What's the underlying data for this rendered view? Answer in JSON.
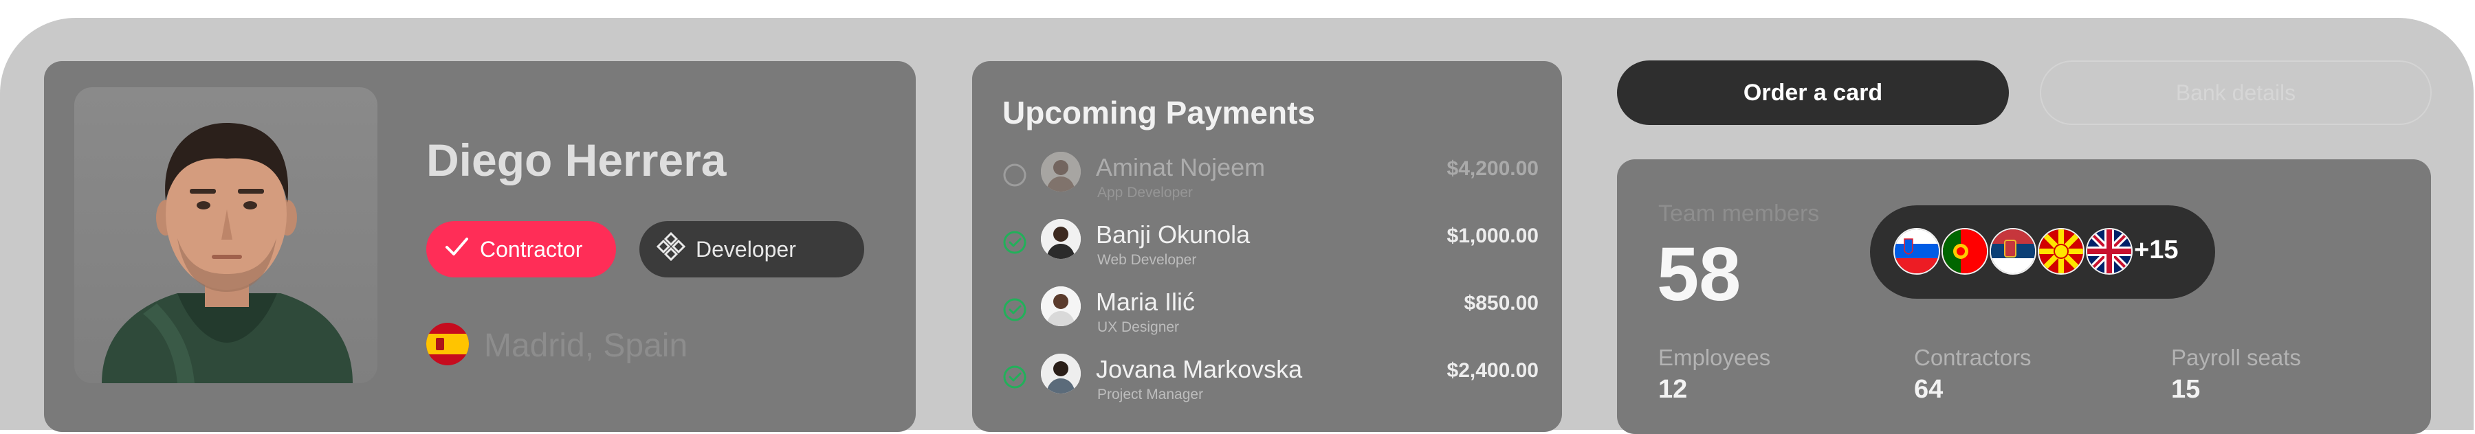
{
  "profile": {
    "name": "Diego Herrera",
    "tags": [
      "Contractor",
      "Developer"
    ],
    "location": "Madrid, Spain"
  },
  "payments": {
    "title": "Upcoming Payments",
    "items": [
      {
        "name": "Aminat Nojeem",
        "role": "App Developer",
        "amount": "$4,200.00",
        "status": "pending"
      },
      {
        "name": "Banji Okunola",
        "role": "Web Developer",
        "amount": "$1,000.00",
        "status": "done"
      },
      {
        "name": "Maria Ilić",
        "role": "UX Designer",
        "amount": "$850.00",
        "status": "done"
      },
      {
        "name": "Jovana Markovska",
        "role": "Project Manager",
        "amount": "$2,400.00",
        "status": "done"
      }
    ]
  },
  "actions": {
    "order_card": "Order a card",
    "bank_details": "Bank details"
  },
  "team": {
    "label": "Team members",
    "count": "58",
    "flags": [
      "slovenia-flag",
      "portugal-flag",
      "serbia-flag",
      "north-macedonia-flag",
      "uk-flag"
    ],
    "more": "+15",
    "stats": [
      {
        "label": "Employees",
        "value": "12"
      },
      {
        "label": "Contractors",
        "value": "64"
      },
      {
        "label": "Payroll seats",
        "value": "15"
      }
    ]
  },
  "colors": {
    "accent": "#ff2d57",
    "check_green": "#22b05a",
    "dark": "#2e2e2e"
  }
}
